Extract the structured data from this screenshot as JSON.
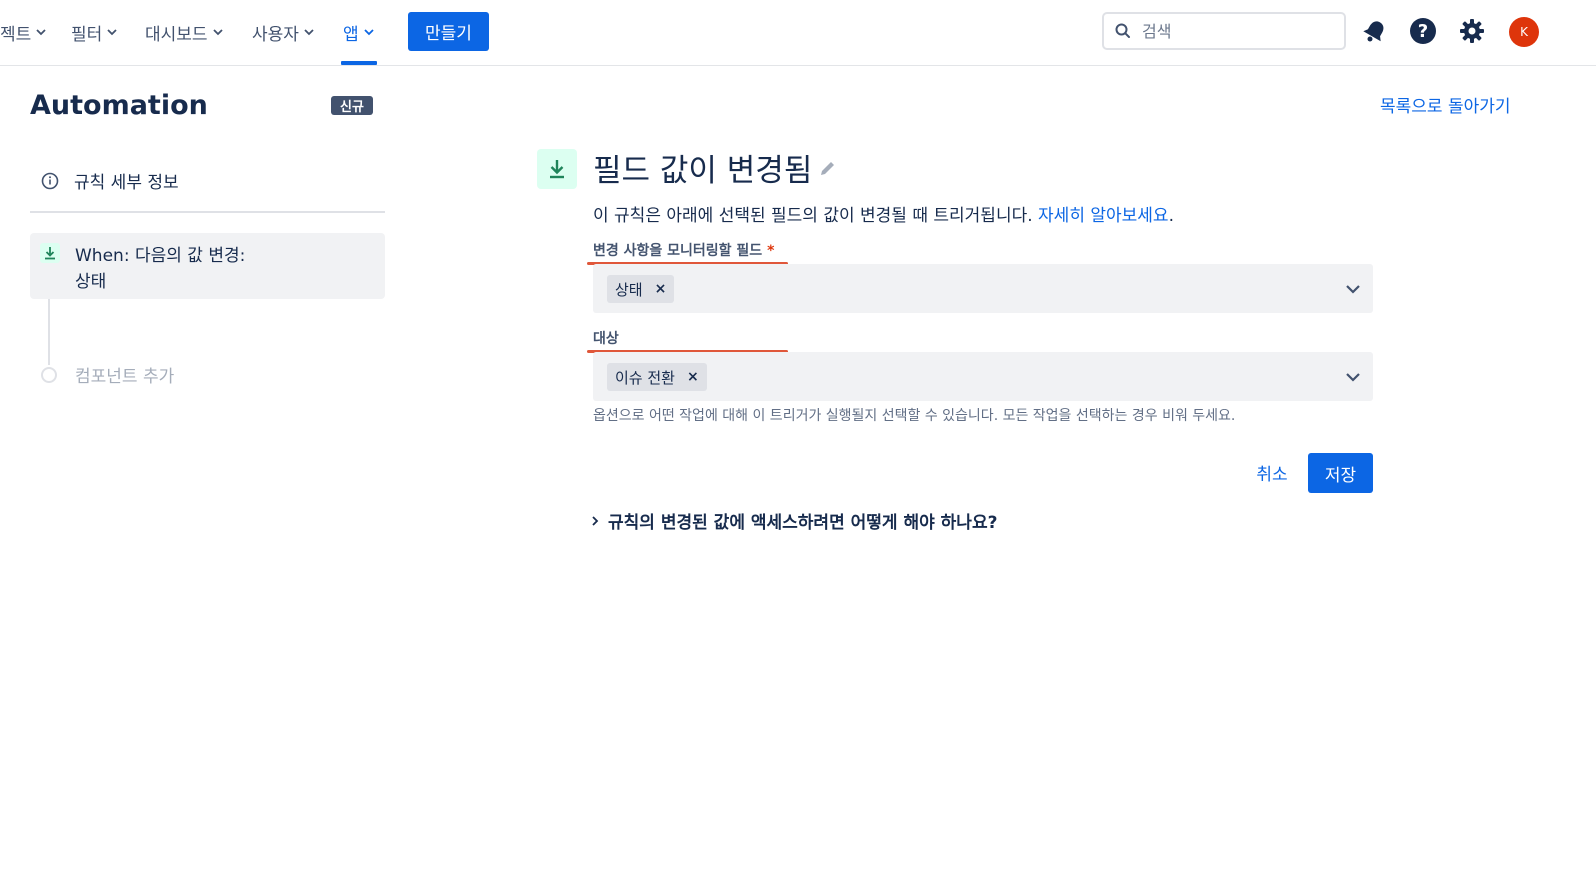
{
  "nav": {
    "items": [
      {
        "label": "젝트"
      },
      {
        "label": "필터"
      },
      {
        "label": "대시보드"
      },
      {
        "label": "사용자"
      },
      {
        "label": "앱"
      }
    ],
    "create_label": "만들기",
    "search_placeholder": "검색",
    "avatar_initial": "K",
    "accent_color": "#0c66e4"
  },
  "sidebar": {
    "title": "Automation",
    "badge": "신규",
    "rule_details_label": "규칙 세부 정보",
    "trigger_label_line1": "When: 다음의 값 변경:",
    "trigger_label_line2": "상태",
    "add_component_label": "컴포넌트 추가"
  },
  "main": {
    "back_link": "목록으로 돌아가기",
    "title": "필드 값이 변경됨",
    "description": "이 규칙은 아래에 선택된 필드의 값이 변경될 때 트리거됩니다.",
    "learn_more": "자세히 알아보세요",
    "description_end": ".",
    "field1_label": "변경 사항을 모니터링할 필드",
    "field1_required": "*",
    "field1_tag": "상태",
    "field2_label": "대상",
    "field2_tag": "이슈 전환",
    "helper_text": "옵션으로 어떤 작업에 대해 이 트리거가 실행될지 선택할 수 있습니다. 모든 작업을 선택하는 경우 비워 두세요.",
    "cancel_label": "취소",
    "save_label": "저장",
    "faq_label": "규칙의 변경된 값에 액세스하려면 어떻게 해야 하나요?",
    "tag_remove": "×"
  }
}
